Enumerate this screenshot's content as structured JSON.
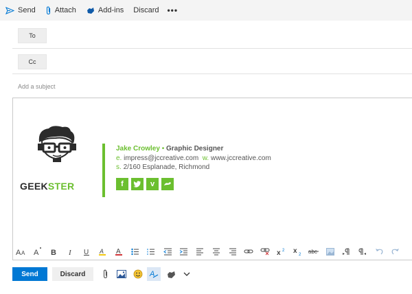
{
  "command_bar": {
    "send_label": "Send",
    "attach_label": "Attach",
    "addins_label": "Add-ins",
    "discard_label": "Discard",
    "more_label": "•••"
  },
  "recipients": {
    "to_label": "To",
    "cc_label": "Cc"
  },
  "subject": {
    "placeholder": "Add a subject",
    "value": ""
  },
  "signature": {
    "logo_text_part1": "GEEK",
    "logo_text_part2": "STER",
    "name": "Jake Crowley",
    "separator": "•",
    "title": "Graphic Designer",
    "email_label": "e.",
    "email": "impress@jccreative.com",
    "web_label": "w.",
    "website": "www.jccreative.com",
    "address_label": "s.",
    "address": "2/160 Esplanade, Richmond",
    "social": [
      "facebook-icon",
      "twitter-icon",
      "vimeo-icon",
      "skype-icon"
    ]
  },
  "format_toolbar": {
    "items": [
      "font-size-icon",
      "grow-font-icon",
      "bold-icon",
      "italic-icon",
      "underline-icon",
      "highlight-icon",
      "font-color-icon",
      "bullets-icon",
      "numbering-icon",
      "decrease-indent-icon",
      "increase-indent-icon",
      "align-left-icon",
      "align-center-icon",
      "align-right-icon",
      "insert-link-icon",
      "remove-link-icon",
      "superscript-icon",
      "subscript-icon",
      "strikethrough-icon",
      "insert-picture-icon",
      "ltr-icon",
      "rtl-icon",
      "undo-icon",
      "redo-icon"
    ]
  },
  "action_bar": {
    "send_label": "Send",
    "discard_label": "Discard"
  },
  "colors": {
    "accent": "#0078d4",
    "brand_green": "#6bbf2f"
  }
}
